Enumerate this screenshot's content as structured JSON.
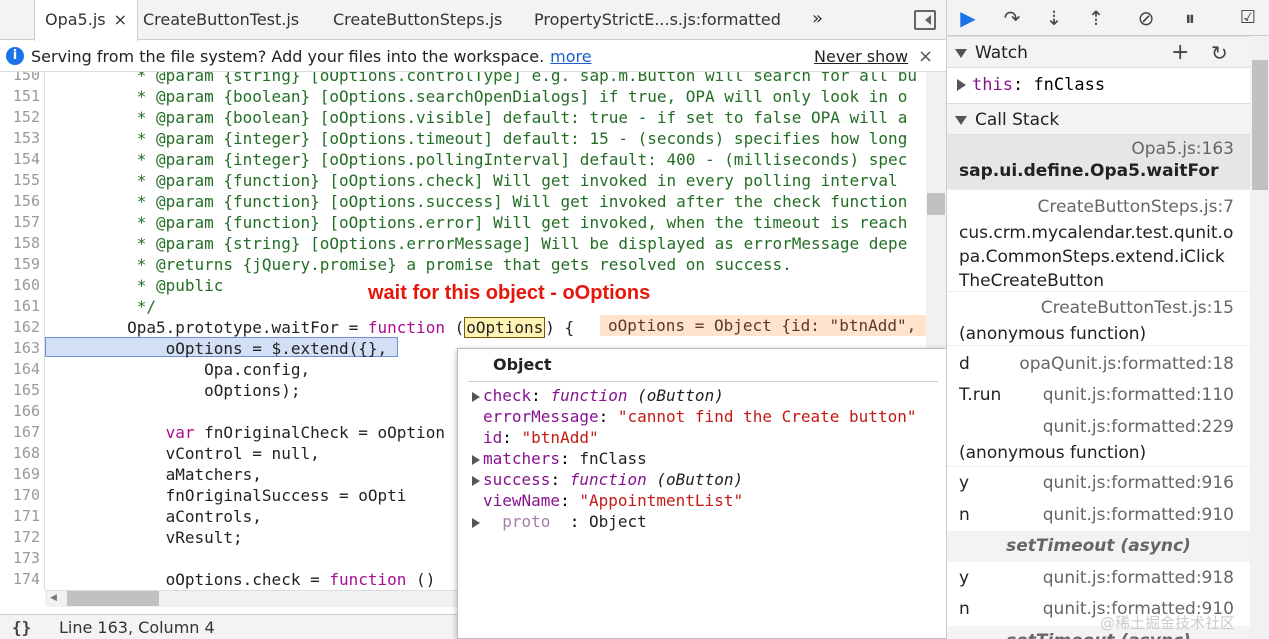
{
  "tabs": [
    {
      "label": "Opa5.js",
      "active": true,
      "close": "×"
    },
    {
      "label": "CreateButtonTest.js"
    },
    {
      "label": "CreateButtonSteps.js"
    },
    {
      "label": "PropertyStrictE...s.js:formatted"
    }
  ],
  "tab_overflow": "»",
  "infobar": {
    "icon": "i",
    "text": "Serving from the file system? Add your files into the workspace.",
    "more_link": "more",
    "never_show": "Never show",
    "close": "×"
  },
  "code": {
    "lines": [
      {
        "n": "150",
        "text": "         * @param {string} [oOptions.controlType] e.g. sap.m.Button will search for all bu"
      },
      {
        "n": "151",
        "text": "         * @param {boolean} [oOptions.searchOpenDialogs] if true, OPA will only look in o"
      },
      {
        "n": "152",
        "text": "         * @param {boolean} [oOptions.visible] default: true - if set to false OPA will a"
      },
      {
        "n": "153",
        "text": "         * @param {integer} [oOptions.timeout] default: 15 - (seconds) specifies how long"
      },
      {
        "n": "154",
        "text": "         * @param {integer} [oOptions.pollingInterval] default: 400 - (milliseconds) spec"
      },
      {
        "n": "155",
        "text": "         * @param {function} [oOptions.check] Will get invoked in every polling interval"
      },
      {
        "n": "156",
        "text": "         * @param {function} [oOptions.success] Will get invoked after the check function"
      },
      {
        "n": "157",
        "text": "         * @param {function} [oOptions.error] Will get invoked, when the timeout is reach"
      },
      {
        "n": "158",
        "text": "         * @param {string} [oOptions.errorMessage] Will be displayed as errorMessage depe"
      },
      {
        "n": "159",
        "text": "         * @returns {jQuery.promise} a promise that gets resolved on success."
      },
      {
        "n": "160",
        "text": "         * @public"
      },
      {
        "n": "161",
        "text": "         */"
      },
      {
        "n": "162",
        "text": ""
      },
      {
        "n": "163",
        "text": ""
      },
      {
        "n": "164",
        "text": "                Opa.config,"
      },
      {
        "n": "165",
        "text": "                oOptions);"
      },
      {
        "n": "166",
        "text": ""
      },
      {
        "n": "167",
        "text": ""
      },
      {
        "n": "168",
        "text": "            vControl = null,"
      },
      {
        "n": "169",
        "text": "            aMatchers,"
      },
      {
        "n": "170",
        "text": "            fnOriginalSuccess = oOpti"
      },
      {
        "n": "171",
        "text": "            aControls,"
      },
      {
        "n": "172",
        "text": "            vResult;"
      },
      {
        "n": "173",
        "text": ""
      },
      {
        "n": "174",
        "text": ""
      },
      {
        "n": "175",
        "text": ""
      }
    ],
    "line162_pre": "        Opa5.prototype.waitFor = ",
    "line162_kw": "function",
    "line162_mid": " (",
    "line162_word": "oOptions",
    "line162_post": ") {",
    "line163_text": "            oOptions = $.extend({},",
    "line167_pre": "            ",
    "line167_kw": "var",
    "line167_post": " fnOriginalCheck = oOption",
    "line174_pre": "            oOptions.check = ",
    "line174_kw": "function",
    "line174_post": " ()",
    "inline_value": "oOptions = Object {id: \"btnAdd\", ",
    "annotation": "wait for this object - oOptions"
  },
  "popover": {
    "title": "Object",
    "props": [
      {
        "expandable": true,
        "key": "check",
        "sep": ": ",
        "type": "fn",
        "kw": "function",
        "val": " (oButton)"
      },
      {
        "expandable": false,
        "key": "errorMessage",
        "sep": ": ",
        "type": "str",
        "val": "\"cannot find the Create button\""
      },
      {
        "expandable": false,
        "key": "id",
        "sep": ": ",
        "type": "str",
        "val": "\"btnAdd\""
      },
      {
        "expandable": true,
        "key": "matchers",
        "sep": ": ",
        "type": "obj",
        "val": "fnClass"
      },
      {
        "expandable": true,
        "key": "success",
        "sep": ": ",
        "type": "fn",
        "kw": "function",
        "val": " (oButton)"
      },
      {
        "expandable": false,
        "key": "viewName",
        "sep": ": ",
        "type": "str",
        "val": "\"AppointmentList\""
      },
      {
        "expandable": true,
        "key": "  proto  ",
        "sep": ": ",
        "type": "obj",
        "val": "Object",
        "dim": true
      }
    ]
  },
  "status": {
    "pretty_print": "{}",
    "cursor": "Line 163, Column 4"
  },
  "debugger": {
    "watch_label": "Watch",
    "watch_add": "+",
    "watch_refresh": "↻",
    "watch_this_key": "this",
    "watch_this_val": "fnClass",
    "callstack_label": "Call Stack",
    "frames_multi": [
      {
        "loc": "Opa5.js:163",
        "name": "sap.ui.define.Opa5.waitFor",
        "selected": true,
        "bold": true
      },
      {
        "loc": "CreateButtonSteps.js:7",
        "name": "cus.crm.mycalendar.test.qunit.opa.CommonSteps.extend.iClickTheCreateButton"
      },
      {
        "loc": "CreateButtonTest.js:15",
        "name": "(anonymous function)"
      }
    ],
    "frame_d": {
      "name": "d",
      "loc": "opaQunit.js:formatted:18"
    },
    "frame_trun": {
      "name": "T.run",
      "loc": "qunit.js:formatted:110"
    },
    "frame_anon2": {
      "loc": "qunit.js:formatted:229",
      "name": "(anonymous function)"
    },
    "frame_y1": {
      "name": "y",
      "loc": "qunit.js:formatted:916"
    },
    "frame_n1": {
      "name": "n",
      "loc": "qunit.js:formatted:910"
    },
    "async1": "setTimeout (async)",
    "frame_y2": {
      "name": "y",
      "loc": "qunit.js:formatted:918"
    },
    "frame_n2": {
      "name": "n",
      "loc": "qunit.js:formatted:910"
    },
    "async2": "setTimeout (async)"
  },
  "watermark": "@稀土掘金技术社区"
}
